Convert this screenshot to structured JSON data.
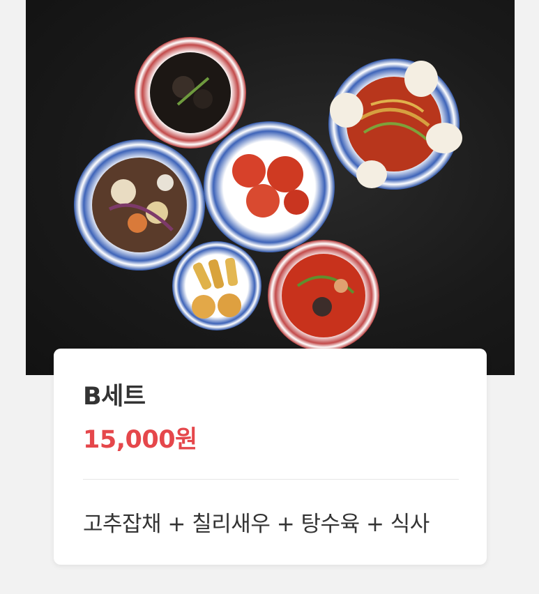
{
  "hero_image": {
    "icon": "food-photo"
  },
  "product": {
    "name": "B세트",
    "price": "15,000원",
    "description": "고추잡채 + 칠리새우 + 탕수육 + 식사"
  },
  "colors": {
    "price": "#e5474b",
    "text": "#333333",
    "card_bg": "#ffffff",
    "page_bg": "#f2f2f2",
    "photo_bg": "#1a1a1a"
  }
}
